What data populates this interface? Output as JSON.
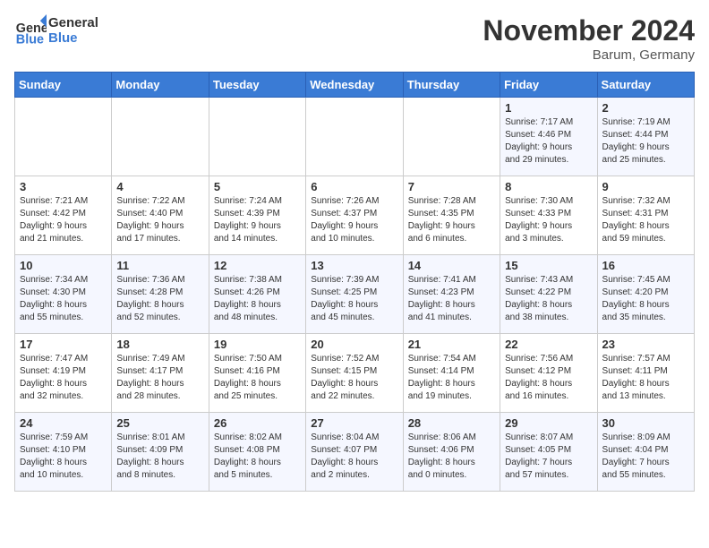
{
  "header": {
    "logo_line1": "General",
    "logo_line2": "Blue",
    "month_title": "November 2024",
    "location": "Barum, Germany"
  },
  "weekdays": [
    "Sunday",
    "Monday",
    "Tuesday",
    "Wednesday",
    "Thursday",
    "Friday",
    "Saturday"
  ],
  "weeks": [
    [
      {
        "day": "",
        "info": ""
      },
      {
        "day": "",
        "info": ""
      },
      {
        "day": "",
        "info": ""
      },
      {
        "day": "",
        "info": ""
      },
      {
        "day": "",
        "info": ""
      },
      {
        "day": "1",
        "info": "Sunrise: 7:17 AM\nSunset: 4:46 PM\nDaylight: 9 hours\nand 29 minutes."
      },
      {
        "day": "2",
        "info": "Sunrise: 7:19 AM\nSunset: 4:44 PM\nDaylight: 9 hours\nand 25 minutes."
      }
    ],
    [
      {
        "day": "3",
        "info": "Sunrise: 7:21 AM\nSunset: 4:42 PM\nDaylight: 9 hours\nand 21 minutes."
      },
      {
        "day": "4",
        "info": "Sunrise: 7:22 AM\nSunset: 4:40 PM\nDaylight: 9 hours\nand 17 minutes."
      },
      {
        "day": "5",
        "info": "Sunrise: 7:24 AM\nSunset: 4:39 PM\nDaylight: 9 hours\nand 14 minutes."
      },
      {
        "day": "6",
        "info": "Sunrise: 7:26 AM\nSunset: 4:37 PM\nDaylight: 9 hours\nand 10 minutes."
      },
      {
        "day": "7",
        "info": "Sunrise: 7:28 AM\nSunset: 4:35 PM\nDaylight: 9 hours\nand 6 minutes."
      },
      {
        "day": "8",
        "info": "Sunrise: 7:30 AM\nSunset: 4:33 PM\nDaylight: 9 hours\nand 3 minutes."
      },
      {
        "day": "9",
        "info": "Sunrise: 7:32 AM\nSunset: 4:31 PM\nDaylight: 8 hours\nand 59 minutes."
      }
    ],
    [
      {
        "day": "10",
        "info": "Sunrise: 7:34 AM\nSunset: 4:30 PM\nDaylight: 8 hours\nand 55 minutes."
      },
      {
        "day": "11",
        "info": "Sunrise: 7:36 AM\nSunset: 4:28 PM\nDaylight: 8 hours\nand 52 minutes."
      },
      {
        "day": "12",
        "info": "Sunrise: 7:38 AM\nSunset: 4:26 PM\nDaylight: 8 hours\nand 48 minutes."
      },
      {
        "day": "13",
        "info": "Sunrise: 7:39 AM\nSunset: 4:25 PM\nDaylight: 8 hours\nand 45 minutes."
      },
      {
        "day": "14",
        "info": "Sunrise: 7:41 AM\nSunset: 4:23 PM\nDaylight: 8 hours\nand 41 minutes."
      },
      {
        "day": "15",
        "info": "Sunrise: 7:43 AM\nSunset: 4:22 PM\nDaylight: 8 hours\nand 38 minutes."
      },
      {
        "day": "16",
        "info": "Sunrise: 7:45 AM\nSunset: 4:20 PM\nDaylight: 8 hours\nand 35 minutes."
      }
    ],
    [
      {
        "day": "17",
        "info": "Sunrise: 7:47 AM\nSunset: 4:19 PM\nDaylight: 8 hours\nand 32 minutes."
      },
      {
        "day": "18",
        "info": "Sunrise: 7:49 AM\nSunset: 4:17 PM\nDaylight: 8 hours\nand 28 minutes."
      },
      {
        "day": "19",
        "info": "Sunrise: 7:50 AM\nSunset: 4:16 PM\nDaylight: 8 hours\nand 25 minutes."
      },
      {
        "day": "20",
        "info": "Sunrise: 7:52 AM\nSunset: 4:15 PM\nDaylight: 8 hours\nand 22 minutes."
      },
      {
        "day": "21",
        "info": "Sunrise: 7:54 AM\nSunset: 4:14 PM\nDaylight: 8 hours\nand 19 minutes."
      },
      {
        "day": "22",
        "info": "Sunrise: 7:56 AM\nSunset: 4:12 PM\nDaylight: 8 hours\nand 16 minutes."
      },
      {
        "day": "23",
        "info": "Sunrise: 7:57 AM\nSunset: 4:11 PM\nDaylight: 8 hours\nand 13 minutes."
      }
    ],
    [
      {
        "day": "24",
        "info": "Sunrise: 7:59 AM\nSunset: 4:10 PM\nDaylight: 8 hours\nand 10 minutes."
      },
      {
        "day": "25",
        "info": "Sunrise: 8:01 AM\nSunset: 4:09 PM\nDaylight: 8 hours\nand 8 minutes."
      },
      {
        "day": "26",
        "info": "Sunrise: 8:02 AM\nSunset: 4:08 PM\nDaylight: 8 hours\nand 5 minutes."
      },
      {
        "day": "27",
        "info": "Sunrise: 8:04 AM\nSunset: 4:07 PM\nDaylight: 8 hours\nand 2 minutes."
      },
      {
        "day": "28",
        "info": "Sunrise: 8:06 AM\nSunset: 4:06 PM\nDaylight: 8 hours\nand 0 minutes."
      },
      {
        "day": "29",
        "info": "Sunrise: 8:07 AM\nSunset: 4:05 PM\nDaylight: 7 hours\nand 57 minutes."
      },
      {
        "day": "30",
        "info": "Sunrise: 8:09 AM\nSunset: 4:04 PM\nDaylight: 7 hours\nand 55 minutes."
      }
    ]
  ]
}
